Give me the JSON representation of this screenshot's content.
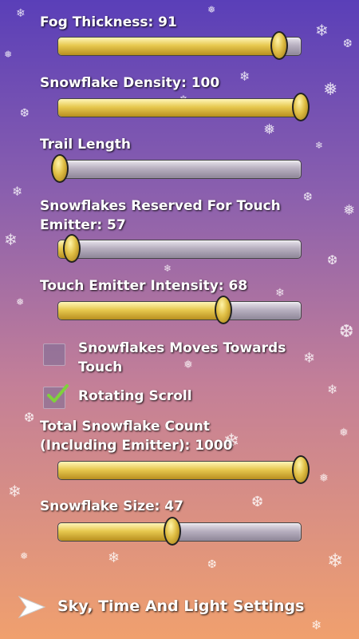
{
  "settings": {
    "fog_thickness": {
      "label": "Fog Thickness: 91",
      "value": 91,
      "max": 100
    },
    "snowflake_density": {
      "label": "Snowflake Density: 100",
      "value": 100,
      "max": 100
    },
    "trail_length": {
      "label": "Trail Length",
      "value": 0,
      "max": 100
    },
    "reserved_for_touch": {
      "label": "Snowflakes Reserved For Touch Emitter: 57",
      "value": 57,
      "max": 1000
    },
    "touch_emitter_intensity": {
      "label": "Touch Emitter Intensity: 68",
      "value": 68,
      "max": 100
    },
    "moves_towards_touch": {
      "label": "Snowflakes Moves Towards Touch",
      "checked": false
    },
    "rotating_scroll": {
      "label": "Rotating Scroll",
      "checked": true
    },
    "total_count": {
      "label": "Total Snowflake Count (Including Emitter): 1000",
      "value": 1000,
      "max": 1000
    },
    "snowflake_size": {
      "label": "Snowflake Size: 47",
      "value": 47,
      "max": 100
    }
  },
  "footer": {
    "link_label": "Sky, Time And Light Settings"
  },
  "colors": {
    "slider_fill": "#e7c94f",
    "slider_track": "#b8b0c0",
    "check_green": "#7fd13b"
  }
}
